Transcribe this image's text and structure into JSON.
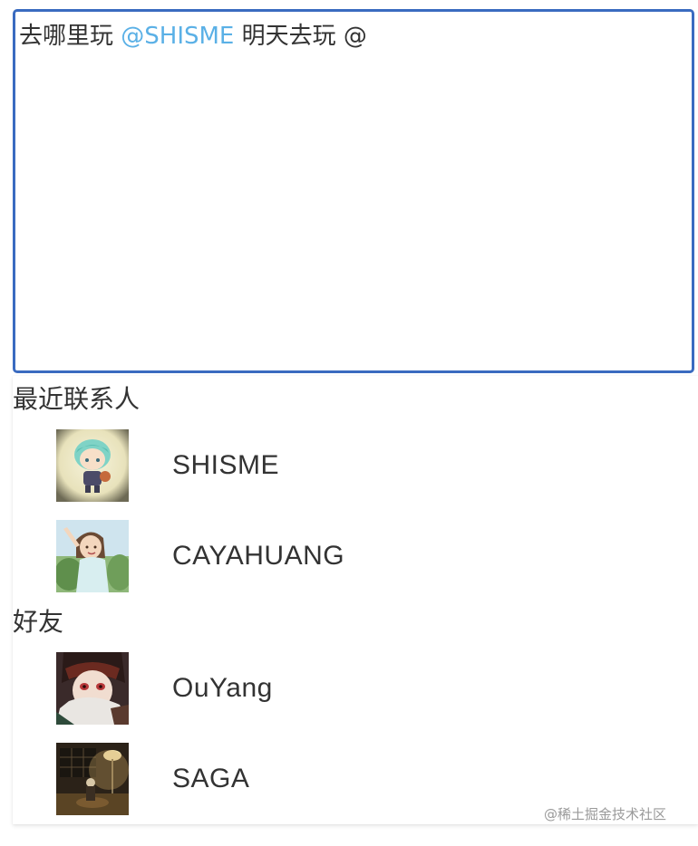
{
  "editor": {
    "text_before": "去哪里玩 ",
    "mention": "@SHISME",
    "text_after": " 明天去玩 @",
    "colors": {
      "border": "#3a6bc0",
      "mention": "#5ab0e6"
    }
  },
  "groups": [
    {
      "title": "最近联系人",
      "contacts": [
        {
          "name": "SHISME",
          "avatar_icon": "anime-chibi-avatar-icon"
        },
        {
          "name": "CAYAHUANG",
          "avatar_icon": "anime-girl-avatar-icon"
        }
      ]
    },
    {
      "title": "好友",
      "contacts": [
        {
          "name": "OuYang",
          "avatar_icon": "anime-boy-avatar-icon"
        },
        {
          "name": "SAGA",
          "avatar_icon": "lamp-room-avatar-icon"
        }
      ]
    }
  ],
  "watermark": "@稀土掘金技术社区"
}
